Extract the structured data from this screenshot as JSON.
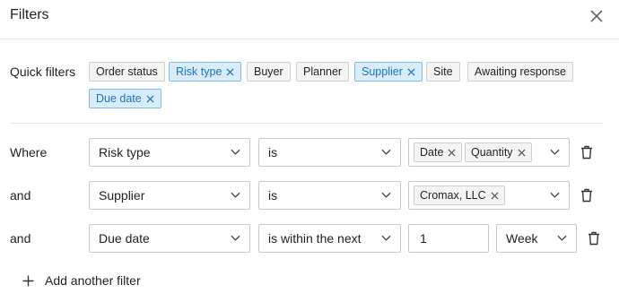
{
  "header": {
    "title": "Filters",
    "close_icon": "close-icon"
  },
  "quick_filters": {
    "label": "Quick filters",
    "chips": [
      {
        "label": "Order status",
        "active": false
      },
      {
        "label": "Risk type",
        "active": true
      },
      {
        "label": "Buyer",
        "active": false
      },
      {
        "label": "Planner",
        "active": false
      },
      {
        "label": "Supplier",
        "active": true
      },
      {
        "label": "Site",
        "active": false
      },
      {
        "label": "Awaiting response",
        "active": false
      },
      {
        "label": "Due date",
        "active": true
      }
    ]
  },
  "filters": [
    {
      "connector": "Where",
      "field": "Risk type",
      "operator": "is",
      "values": [
        "Date",
        "Quantity"
      ]
    },
    {
      "connector": "and",
      "field": "Supplier",
      "operator": "is",
      "values": [
        "Cromax, LLC"
      ]
    },
    {
      "connector": "and",
      "field": "Due date",
      "operator": "is within the next",
      "amount": "1",
      "unit": "Week"
    }
  ],
  "add_filter_label": "Add another filter",
  "colors": {
    "active_chip_bg": "#d9ecfa",
    "active_chip_text": "#1a73c4",
    "border": "#c9c9c9"
  }
}
